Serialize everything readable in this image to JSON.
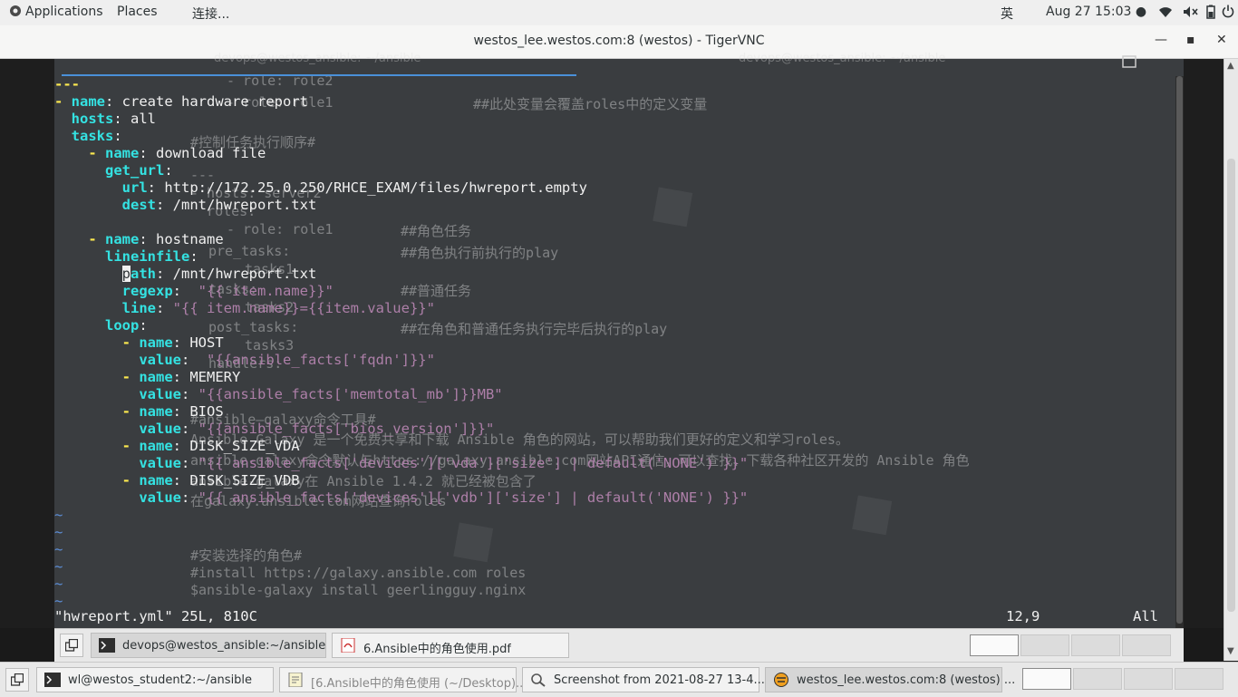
{
  "topbar": {
    "applications": "Applications",
    "places": "Places",
    "connect": "连接...",
    "input_method": "英",
    "datetime": "Aug 27  15:03 ●",
    "icons": [
      "wifi-icon",
      "volume-muted-icon",
      "battery-icon",
      "power-icon"
    ]
  },
  "window": {
    "title": "westos_lee.westos.com:8 (westos) - TigerVNC",
    "minimize": "—",
    "maximize": "▪",
    "close": "✕"
  },
  "background_doc": {
    "lines": [
      "- role: role2",
      "- role: role1",
      "##此处变量会覆盖roles中的定义变量",
      "#控制任务执行顺序#",
      "---",
      "- hosts: server2",
      "  roles:",
      "- role: role1",
      "##角色任务",
      "pre_tasks:",
      "##角色执行前执行的play",
      "tasks1",
      "tasks:",
      "##普通任务",
      "tasks2",
      "post_tasks:",
      "##在角色和普通任务执行完毕后执行的play",
      "tasks3",
      "handlers:",
      "#ansible—galaxy命令工具#",
      "Ansible Galaxy 是一个免费共享和下载 Ansible 角色的网站，可以帮助我们更好的定义和学习roles。",
      "ansible-galaxy命令默认与https://galaxy.ansible.com网站API通信，可以查找、下载各种社区开发的 Ansible 角色",
      "ansible-galaxy在 Ansible 1.4.2 就已经被包含了",
      "在galaxy.ansible.com网站查询roles",
      "#安装选择的角色#",
      "#install https://galaxy.ansible.com roles",
      "$ansible-galaxy install geerlingguy.nginx"
    ],
    "tab_left": "devops@westos_ansible: ~/ansible",
    "tab_right": "devops@westos_ansible: ~/ansible"
  },
  "editor": {
    "doc_start": "---",
    "play_dash": "- ",
    "k_name": "name",
    "k_hosts": "hosts",
    "k_tasks": "tasks",
    "k_get_url": "get_url",
    "k_url": "url",
    "k_dest": "dest",
    "k_lineinfile": "lineinfile",
    "k_path_rest": "ath",
    "cursor_char": "p",
    "k_regexp": "regexp",
    "k_line": "line",
    "k_loop": "loop",
    "k_value": "value",
    "v_play_name": "create hardware report",
    "v_hosts": "all",
    "v_task1": "download file",
    "v_url": "http://172.25.0.250/RHCE_EXAM/files/hwreport.empty",
    "v_dest": "/mnt/hwreport.txt",
    "v_task2": "hostname",
    "v_path": "/mnt/hwreport.txt",
    "v_regexp": "\"{{ item.name}}\"",
    "v_line": "\"{{ item.name}}={{item.value}}\"",
    "loop_items": [
      {
        "name": "HOST",
        "value": "\"{{ansible_facts['fqdn']}}\""
      },
      {
        "name": "MEMERY",
        "value": "\"{{ansible_facts['memtotal_mb']}}MB\""
      },
      {
        "name": "BIOS",
        "value": "\"{{ansible_facts['bios_version']}}\""
      },
      {
        "name": "DISK_SIZE_VDA",
        "value": "\"{{ ansible_facts['devices']['vda']['size'] | default('NONE') }}\""
      },
      {
        "name": "DISK_SIZE_VDB",
        "value": "\"{{ ansible_facts['devices']['vdb']['size'] | default('NONE') }}\""
      }
    ],
    "tilde": "~"
  },
  "statusline": {
    "file_info": "\"hwreport.yml\" 25L, 810C",
    "position": "12,9",
    "scroll": "All"
  },
  "inner_taskbar": {
    "items": [
      {
        "label": "devops@westos_ansible:~/ansible",
        "icon": "terminal-icon"
      },
      {
        "label": "6.Ansible中的角色使用.pdf",
        "icon": "pdf-icon"
      }
    ]
  },
  "bottom_taskbar": {
    "items": [
      {
        "label": "wl@westos_student2:~/ansible",
        "icon": "terminal-icon"
      },
      {
        "label": "[6.Ansible中的角色使用 (~/Desktop)...",
        "icon": "text-editor-icon"
      },
      {
        "label": "Screenshot from 2021-08-27 13-4...",
        "icon": "image-viewer-icon"
      },
      {
        "label": "westos_lee.westos.com:8 (westos) ...",
        "icon": "tigervnc-icon"
      }
    ]
  }
}
